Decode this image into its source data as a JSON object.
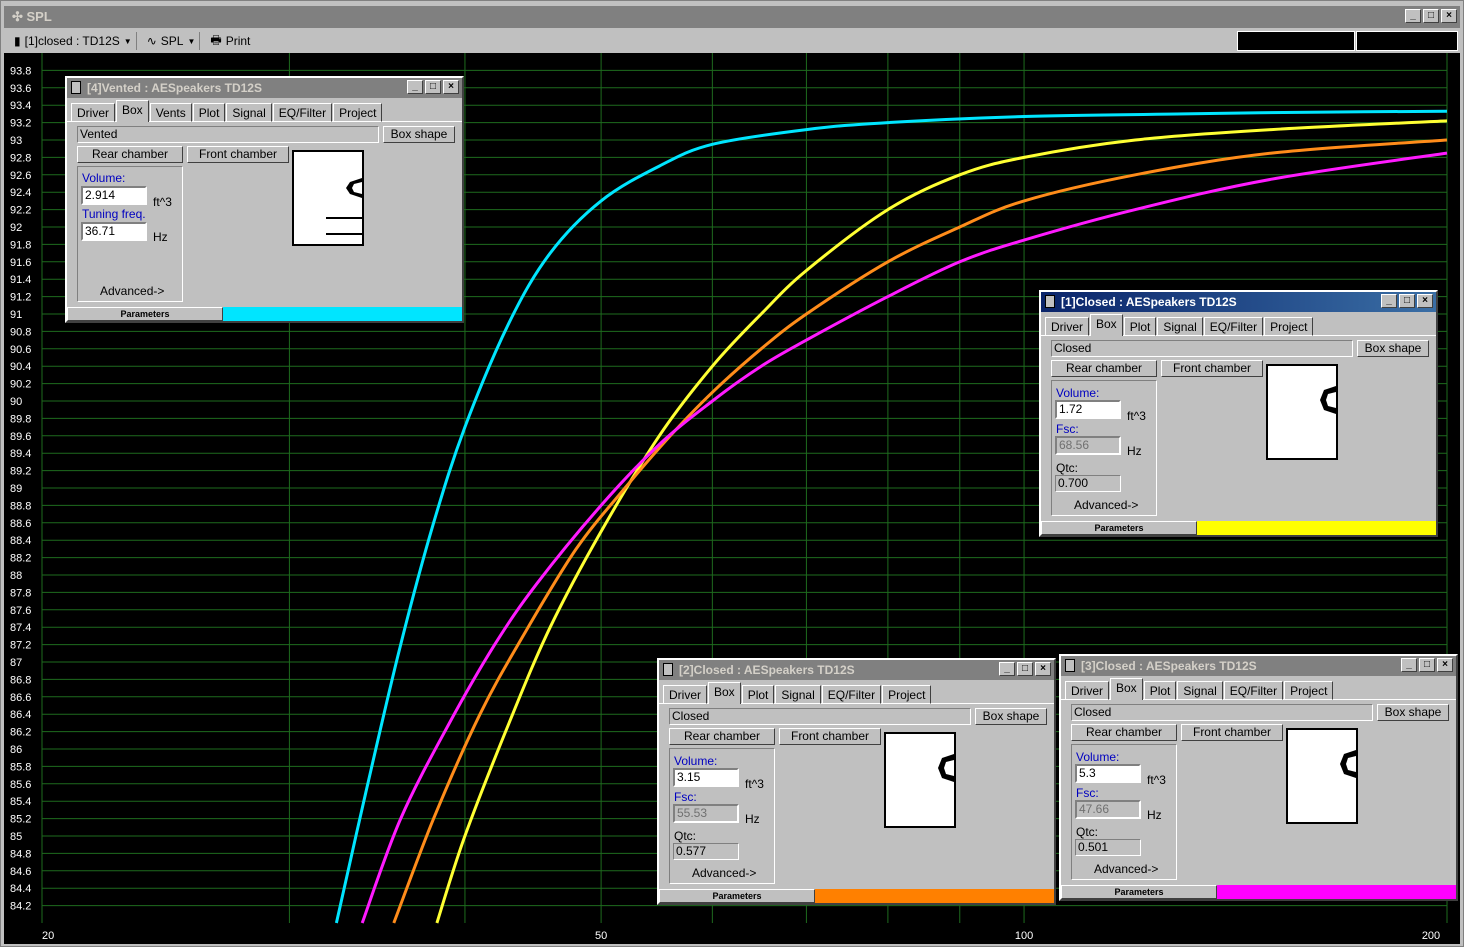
{
  "app": {
    "title": "SPL",
    "toolbar": {
      "driver_select": "[1]closed : TD12S",
      "view_label": "SPL",
      "print_label": "Print"
    }
  },
  "chart_data": {
    "type": "line",
    "xscale": "log",
    "xlim": [
      20,
      200
    ],
    "ylim": [
      84,
      94
    ],
    "x_ticks": [
      "20",
      "50",
      "100",
      "200"
    ],
    "y_ticks": [
      "93.8",
      "93.6",
      "93.4",
      "93.2",
      "93",
      "92.8",
      "92.6",
      "92.4",
      "92.2",
      "92",
      "91.8",
      "91.6",
      "91.4",
      "91.2",
      "91",
      "90.8",
      "90.6",
      "90.4",
      "90.2",
      "90",
      "89.8",
      "89.6",
      "89.4",
      "89.2",
      "89",
      "88.8",
      "88.6",
      "88.4",
      "88.2",
      "88",
      "87.8",
      "87.6",
      "87.4",
      "87.2",
      "87",
      "86.8",
      "86.6",
      "86.4",
      "86.2",
      "86",
      "85.8",
      "85.6",
      "85.4",
      "85.2",
      "85",
      "84.8",
      "84.6",
      "84.4",
      "84.2"
    ],
    "grid": true,
    "series": [
      {
        "color": "#00e5ff",
        "x": [
          32.4,
          34,
          36,
          38,
          40,
          43,
          46,
          50,
          55,
          60,
          70,
          80,
          100,
          130,
          160,
          200
        ],
        "y": [
          84.0,
          85.5,
          87.2,
          88.6,
          89.7,
          90.9,
          91.7,
          92.3,
          92.7,
          92.95,
          93.12,
          93.2,
          93.27,
          93.3,
          93.32,
          93.33
        ]
      },
      {
        "color": "#ffff33",
        "x": [
          38.2,
          40,
          43,
          46,
          50,
          55,
          60,
          65,
          70,
          80,
          90,
          100,
          120,
          150,
          200
        ],
        "y": [
          84.0,
          85.0,
          86.3,
          87.4,
          88.5,
          89.6,
          90.4,
          91.0,
          91.5,
          92.2,
          92.6,
          92.8,
          93.0,
          93.12,
          93.22
        ]
      },
      {
        "color": "#ff8c1a",
        "x": [
          35.6,
          38,
          41,
          44,
          48,
          52,
          56,
          60,
          65,
          70,
          80,
          90,
          100,
          120,
          150,
          200
        ],
        "y": [
          84.0,
          85.2,
          86.4,
          87.3,
          88.3,
          89.0,
          89.6,
          90.1,
          90.6,
          91.0,
          91.6,
          92.0,
          92.3,
          92.6,
          92.85,
          93.0
        ]
      },
      {
        "color": "#ff1aff",
        "x": [
          33.8,
          36,
          39,
          42,
          45,
          50,
          55,
          60,
          65,
          70,
          80,
          90,
          100,
          120,
          150,
          200
        ],
        "y": [
          84.0,
          85.2,
          86.3,
          87.2,
          87.9,
          88.8,
          89.5,
          90.0,
          90.4,
          90.7,
          91.2,
          91.6,
          91.85,
          92.2,
          92.55,
          92.85
        ]
      }
    ]
  },
  "dialogs": [
    {
      "title": "[4]Vented : AESpeakers TD12S",
      "tabs": [
        "Driver",
        "Box",
        "Vents",
        "Plot",
        "Signal",
        "EQ/Filter",
        "Project"
      ],
      "box_type": "Vented",
      "box_shape_btn": "Box shape",
      "rear_btn": "Rear chamber",
      "front_btn": "Front chamber",
      "f1_label": "Volume:",
      "f1_value": "2.914",
      "f1_unit": "ft^3",
      "f2_label": "Tuning freq.",
      "f2_value": "36.71",
      "f2_unit": "Hz",
      "advanced": "Advanced->",
      "status": "Parameters",
      "color": "#00e5ff"
    },
    {
      "title": "[1]Closed : AESpeakers TD12S",
      "tabs": [
        "Driver",
        "Box",
        "Plot",
        "Signal",
        "EQ/Filter",
        "Project"
      ],
      "box_type": "Closed",
      "box_shape_btn": "Box shape",
      "rear_btn": "Rear chamber",
      "front_btn": "Front chamber",
      "f1_label": "Volume:",
      "f1_value": "1.72",
      "f1_unit": "ft^3",
      "f2_label": "Fsc:",
      "f2_value": "68.56",
      "f2_unit": "Hz",
      "f3_label": "Qtc:",
      "f3_value": "0.700",
      "advanced": "Advanced->",
      "status": "Parameters",
      "color": "#ffff00"
    },
    {
      "title": "[2]Closed : AESpeakers TD12S",
      "tabs": [
        "Driver",
        "Box",
        "Plot",
        "Signal",
        "EQ/Filter",
        "Project"
      ],
      "box_type": "Closed",
      "box_shape_btn": "Box shape",
      "rear_btn": "Rear chamber",
      "front_btn": "Front chamber",
      "f1_label": "Volume:",
      "f1_value": "3.15",
      "f1_unit": "ft^3",
      "f2_label": "Fsc:",
      "f2_value": "55.53",
      "f2_unit": "Hz",
      "f3_label": "Qtc:",
      "f3_value": "0.577",
      "advanced": "Advanced->",
      "status": "Parameters",
      "color": "#ff8000"
    },
    {
      "title": "[3]Closed : AESpeakers TD12S",
      "tabs": [
        "Driver",
        "Box",
        "Plot",
        "Signal",
        "EQ/Filter",
        "Project"
      ],
      "box_type": "Closed",
      "box_shape_btn": "Box shape",
      "rear_btn": "Rear chamber",
      "front_btn": "Front chamber",
      "f1_label": "Volume:",
      "f1_value": "5.3",
      "f1_unit": "ft^3",
      "f2_label": "Fsc:",
      "f2_value": "47.66",
      "f2_unit": "Hz",
      "f3_label": "Qtc:",
      "f3_value": "0.501",
      "advanced": "Advanced->",
      "status": "Parameters",
      "color": "#ff00ff"
    }
  ]
}
